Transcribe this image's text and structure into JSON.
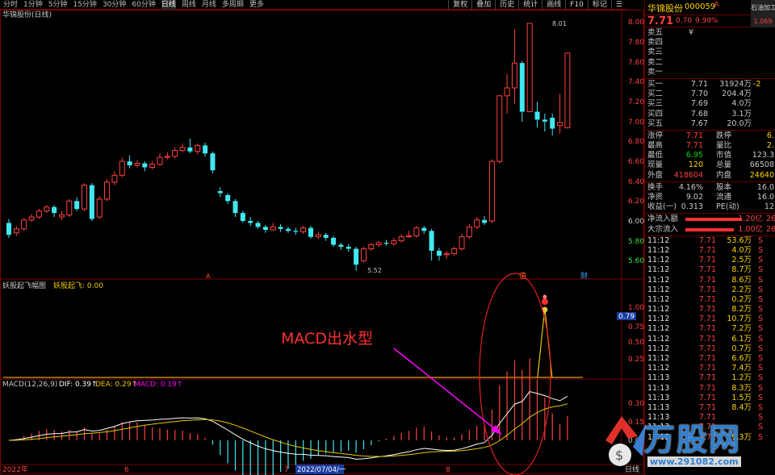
{
  "topbar": {
    "periods": [
      "分时",
      "1分钟",
      "5分钟",
      "15分钟",
      "30分钟",
      "60分钟",
      "日线",
      "周线",
      "月线",
      "多周期",
      "更多"
    ],
    "active_period": "日线",
    "tools": [
      "复权",
      "叠加",
      "历史",
      "统计",
      "画线",
      "F10",
      "标记",
      "☰"
    ]
  },
  "chart": {
    "main_title": "华锦股份(日线)",
    "y_labels": [
      "8.00",
      "7.80",
      "7.60",
      "7.40",
      "7.20",
      "7.00",
      "6.80",
      "6.60",
      "6.40",
      "6.20",
      "6.00",
      "5.80",
      "5.60"
    ],
    "high_label": "8.01",
    "low_label": "5.52",
    "markers": [
      "A",
      "值",
      "财"
    ],
    "indicator_name": "妖股起飞幅图",
    "indicator_value": "妖股起飞: 0.00",
    "ind_y_labels": [
      "1.00",
      "0.75",
      "0.50",
      "0.25"
    ],
    "ind_current": "0.79",
    "annotation": "MACD出水型",
    "macd_title": "MACD(12,26,9)",
    "dif": "DIF: 0.39↑",
    "dea": "DEA: 0.29↑",
    "macd_val": "MACD: 0.19↑",
    "macd_y_labels": [
      "0.30",
      "0.15",
      "0.00"
    ],
    "date_labels": [
      "2022年",
      "6",
      "7",
      "2022/07/04/一",
      "8"
    ],
    "bottom_tab": "日线"
  },
  "right_panel": {
    "name": "华锦股份",
    "code": "000059",
    "code_sup": "R",
    "mini_tag": "石油加工",
    "mini_tag2": "1.069",
    "price": "7.71",
    "change": "0.70",
    "pct": "9.99%",
    "sell": [
      {
        "label": "卖五",
        "price": "¥",
        "vol": ""
      },
      {
        "label": "卖四",
        "price": "",
        "vol": ""
      },
      {
        "label": "卖三",
        "price": "",
        "vol": ""
      },
      {
        "label": "卖二",
        "price": "",
        "vol": ""
      },
      {
        "label": "卖一",
        "price": "",
        "vol": ""
      }
    ],
    "buy": [
      {
        "label": "买一",
        "price": "7.71",
        "vol": "31924万",
        "extra": "-2"
      },
      {
        "label": "买二",
        "price": "7.70",
        "vol": "204.4万",
        "extra": ""
      },
      {
        "label": "买三",
        "price": "7.69",
        "vol": "4.0万",
        "extra": ""
      },
      {
        "label": "买四",
        "price": "7.68",
        "vol": "3.1万",
        "extra": ""
      },
      {
        "label": "买五",
        "price": "7.67",
        "vol": "20.0万",
        "extra": ""
      }
    ],
    "stats": [
      {
        "k1": "涨停",
        "v1": "7.71",
        "k2": "跌停",
        "v2": "6."
      },
      {
        "k1": "最高",
        "v1": "7.71",
        "k2": "量比",
        "v2": "2."
      },
      {
        "k1": "最低",
        "v1": "6.95",
        "k2": "市值",
        "v2": "123.3"
      },
      {
        "k1": "现量",
        "v1": "120",
        "k2": "总量",
        "v2": "66508"
      },
      {
        "k1": "外盘",
        "v1": "418604",
        "k2": "内盘",
        "v2": "24640"
      }
    ],
    "fund": [
      {
        "k1": "换手",
        "v1": "4.16%",
        "k2": "股本",
        "v2": "16.0"
      },
      {
        "k1": "净资",
        "v1": "9.02",
        "k2": "流通",
        "v2": "16.0"
      },
      {
        "k1": "收益(一)",
        "v1": "0.313",
        "k2": "PE(动)",
        "v2": "12"
      }
    ],
    "flows": [
      {
        "label": "净流入额",
        "val": "1.20亿",
        "extra": "26"
      },
      {
        "label": "大宗流入",
        "val": "1.00亿",
        "extra": "26"
      }
    ],
    "ticks": [
      {
        "t": "11:12",
        "p": "7.71",
        "v": "53.6万",
        "s": "S"
      },
      {
        "t": "11:12",
        "p": "7.71",
        "v": "4.0万",
        "s": "S"
      },
      {
        "t": "11:12",
        "p": "7.71",
        "v": "2.5万",
        "s": "S"
      },
      {
        "t": "11:12",
        "p": "7.71",
        "v": "8.7万",
        "s": "S"
      },
      {
        "t": "11:12",
        "p": "7.71",
        "v": "8.6万",
        "s": "S"
      },
      {
        "t": "11:12",
        "p": "7.71",
        "v": "2.2万",
        "s": "S"
      },
      {
        "t": "11:12",
        "p": "7.71",
        "v": "0.2万",
        "s": "S"
      },
      {
        "t": "11:12",
        "p": "7.71",
        "v": "8.2万",
        "s": "S"
      },
      {
        "t": "11:12",
        "p": "7.71",
        "v": "10.7万",
        "s": "S"
      },
      {
        "t": "11:12",
        "p": "7.71",
        "v": "7.2万",
        "s": "S"
      },
      {
        "t": "11:12",
        "p": "7.71",
        "v": "6.1万",
        "s": "S"
      },
      {
        "t": "11:12",
        "p": "7.71",
        "v": "0.7万",
        "s": "S"
      },
      {
        "t": "11:12",
        "p": "7.71",
        "v": "6.6万",
        "s": "S"
      },
      {
        "t": "11:12",
        "p": "7.71",
        "v": "7.4万",
        "s": "S"
      },
      {
        "t": "11:13",
        "p": "7.71",
        "v": "1.2万",
        "s": "S"
      },
      {
        "t": "11:13",
        "p": "7.71",
        "v": "8.3万",
        "s": "S"
      },
      {
        "t": "11:13",
        "p": "7.71",
        "v": "1.5万",
        "s": "S"
      },
      {
        "t": "11:13",
        "p": "7.71",
        "v": "8.4万",
        "s": "S"
      },
      {
        "t": "11:13",
        "p": "7.71",
        "v": "",
        "s": "S"
      },
      {
        "t": "11:13",
        "p": "7.71",
        "v": "",
        "s": "S"
      },
      {
        "t": "11:13",
        "p": "7.71",
        "v": "9.3万",
        "s": "S"
      }
    ]
  },
  "watermark": {
    "logo": "万股网",
    "url": "www.291082.com"
  },
  "colors": {
    "up": "#ff4040",
    "down": "#40e8f0",
    "dif": "#ffffff",
    "dea": "#e8c800",
    "macd": "#ff00ff",
    "frame": "#8b0000"
  },
  "chart_data": {
    "type": "candlestick",
    "title": "华锦股份(日线)",
    "ylim": [
      5.5,
      8.05
    ],
    "candles": [
      [
        6.0,
        5.88,
        6.04,
        5.85
      ],
      [
        5.9,
        5.94,
        5.97,
        5.87
      ],
      [
        5.94,
        6.03,
        6.05,
        5.92
      ],
      [
        6.03,
        6.06,
        6.09,
        6.01
      ],
      [
        6.06,
        6.12,
        6.14,
        6.04
      ],
      [
        6.12,
        6.16,
        6.18,
        6.1
      ],
      [
        6.16,
        6.1,
        6.18,
        6.06
      ],
      [
        6.06,
        6.08,
        6.12,
        6.03
      ],
      [
        6.08,
        6.22,
        6.24,
        6.06
      ],
      [
        6.22,
        6.14,
        6.26,
        6.12
      ],
      [
        6.14,
        6.38,
        6.4,
        6.12
      ],
      [
        6.38,
        6.04,
        6.4,
        6.02
      ],
      [
        6.06,
        6.24,
        6.27,
        6.04
      ],
      [
        6.24,
        6.41,
        6.44,
        6.22
      ],
      [
        6.41,
        6.48,
        6.52,
        6.38
      ],
      [
        6.48,
        6.62,
        6.66,
        6.46
      ],
      [
        6.62,
        6.58,
        6.68,
        6.55
      ],
      [
        6.58,
        6.6,
        6.63,
        6.56
      ],
      [
        6.6,
        6.56,
        6.62,
        6.52
      ],
      [
        6.56,
        6.59,
        6.62,
        6.54
      ],
      [
        6.59,
        6.66,
        6.7,
        6.58
      ],
      [
        6.66,
        6.67,
        6.71,
        6.64
      ],
      [
        6.67,
        6.73,
        6.76,
        6.65
      ],
      [
        6.73,
        6.76,
        6.8,
        6.71
      ],
      [
        6.76,
        6.72,
        6.85,
        6.7
      ],
      [
        6.72,
        6.78,
        6.8,
        6.69
      ],
      [
        6.78,
        6.7,
        6.81,
        6.67
      ],
      [
        6.7,
        6.53,
        6.72,
        6.5
      ],
      [
        6.32,
        6.3,
        6.36,
        6.26
      ],
      [
        6.28,
        6.22,
        6.3,
        6.19
      ],
      [
        6.22,
        6.1,
        6.24,
        6.06
      ],
      [
        6.1,
        6.02,
        6.12,
        6.0
      ],
      [
        6.02,
        6.0,
        6.06,
        5.97
      ],
      [
        6.0,
        5.96,
        6.02,
        5.94
      ],
      [
        5.96,
        5.93,
        5.98,
        5.9
      ],
      [
        5.93,
        5.96,
        6.0,
        5.92
      ],
      [
        5.96,
        5.94,
        5.99,
        5.91
      ],
      [
        5.94,
        5.92,
        5.96,
        5.9
      ],
      [
        5.92,
        5.91,
        5.95,
        5.88
      ],
      [
        5.91,
        5.95,
        5.97,
        5.89
      ],
      [
        5.95,
        5.86,
        5.97,
        5.84
      ],
      [
        5.86,
        5.88,
        5.91,
        5.84
      ],
      [
        5.88,
        5.85,
        5.9,
        5.82
      ],
      [
        5.85,
        5.78,
        5.87,
        5.76
      ],
      [
        5.78,
        5.76,
        5.8,
        5.73
      ],
      [
        5.76,
        5.74,
        5.79,
        5.71
      ],
      [
        5.74,
        5.58,
        5.76,
        5.52
      ],
      [
        5.62,
        5.74,
        5.76,
        5.6
      ],
      [
        5.74,
        5.78,
        5.8,
        5.72
      ],
      [
        5.78,
        5.8,
        5.82,
        5.76
      ],
      [
        5.8,
        5.79,
        5.83,
        5.77
      ],
      [
        5.79,
        5.82,
        5.85,
        5.77
      ],
      [
        5.82,
        5.86,
        5.89,
        5.8
      ],
      [
        5.86,
        5.87,
        5.92,
        5.85
      ],
      [
        5.87,
        5.95,
        5.97,
        5.85
      ],
      [
        5.95,
        5.92,
        5.97,
        5.89
      ],
      [
        5.92,
        5.72,
        5.94,
        5.62
      ],
      [
        5.72,
        5.67,
        5.75,
        5.62
      ],
      [
        5.68,
        5.69,
        5.72,
        5.64
      ],
      [
        5.69,
        5.74,
        5.76,
        5.67
      ],
      [
        5.74,
        5.86,
        5.89,
        5.72
      ],
      [
        5.86,
        5.96,
        5.99,
        5.84
      ],
      [
        5.96,
        6.03,
        6.06,
        5.94
      ],
      [
        6.03,
        6.0,
        6.07,
        5.98
      ],
      [
        6.02,
        6.62,
        6.64,
        6.0
      ],
      [
        6.62,
        7.28,
        7.28,
        6.6
      ],
      [
        7.28,
        7.36,
        7.5,
        7.1
      ],
      [
        7.36,
        7.61,
        7.95,
        7.2
      ],
      [
        7.61,
        7.12,
        7.63,
        7.02
      ],
      [
        7.12,
        8.01,
        8.01,
        7.12
      ],
      [
        7.12,
        7.04,
        7.22,
        6.96
      ],
      [
        7.04,
        7.02,
        7.1,
        6.92
      ],
      [
        7.06,
        6.95,
        7.1,
        6.88
      ],
      [
        6.98,
        7.01,
        7.3,
        6.9
      ],
      [
        6.96,
        7.71,
        7.71,
        6.95
      ]
    ],
    "indicator": {
      "name": "妖股起飞",
      "spike_index": 71,
      "spike_value": 1.0
    },
    "macd": {
      "dif_last": 0.39,
      "dea_last": 0.29,
      "macd_last": 0.19
    }
  }
}
